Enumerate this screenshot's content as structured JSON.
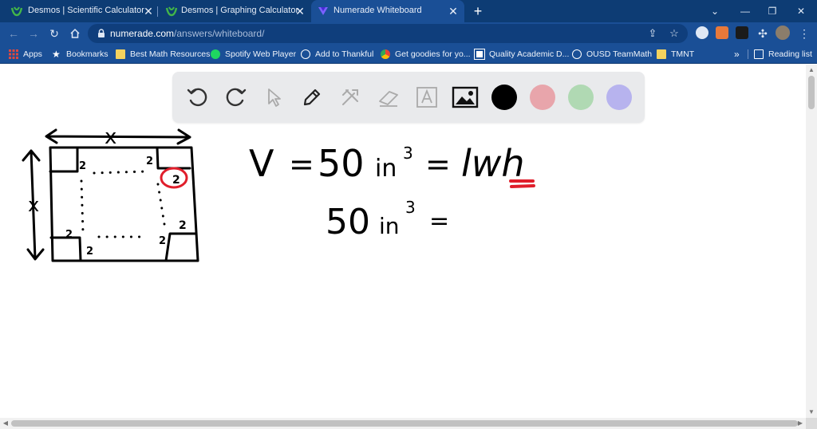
{
  "browser": {
    "tabs": [
      {
        "title": "Desmos | Scientific Calculator",
        "active": false
      },
      {
        "title": "Desmos | Graphing Calculator",
        "active": false
      },
      {
        "title": "Numerade Whiteboard",
        "active": true
      }
    ],
    "new_tab_symbol": "+",
    "url_host": "numerade.com",
    "url_path": "/answers/whiteboard/",
    "bookmarks": [
      {
        "label": "Apps",
        "icon": "apps-grid-icon"
      },
      {
        "label": "Bookmarks",
        "icon": "star-icon"
      },
      {
        "label": "Best Math Resources",
        "icon": "folder-icon"
      },
      {
        "label": "Spotify Web Player",
        "icon": "spotify-icon"
      },
      {
        "label": "Add to Thankful",
        "icon": "globe-icon"
      },
      {
        "label": "Get goodies for yo...",
        "icon": "chrome-icon"
      },
      {
        "label": "Quality Academic D...",
        "icon": "page-icon"
      },
      {
        "label": "OUSD TeamMath",
        "icon": "globe-icon"
      },
      {
        "label": "TMNT",
        "icon": "folder-icon"
      }
    ],
    "reading_list": "Reading list",
    "chevron": "»"
  },
  "whiteboard": {
    "tools": [
      "undo-icon",
      "redo-icon",
      "select-icon",
      "pen-icon",
      "tools-icon",
      "eraser-icon",
      "text-icon",
      "image-icon"
    ],
    "colors": [
      "#000000",
      "#e8a5ab",
      "#b0d9b3",
      "#b7b3ee"
    ],
    "selected_color": "#000000"
  },
  "drawing": {
    "box_side_label": "x",
    "box_height_label": "x",
    "corner_label": "2",
    "equation_1": {
      "lhs": "V",
      "eq": "=",
      "value": "50",
      "unit": "in",
      "exp": "3",
      "rhs": "lwh",
      "underlined": "h"
    },
    "equation_2": {
      "value": "50",
      "unit": "in",
      "exp": "3",
      "eq": "="
    }
  },
  "accent_red": "#e01e2b"
}
